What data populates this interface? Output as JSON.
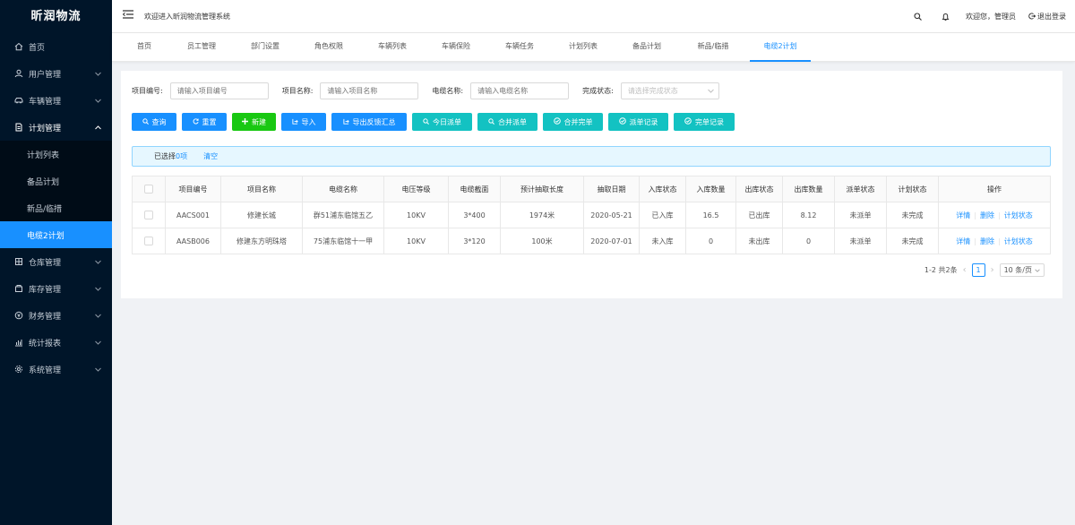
{
  "app": {
    "logo": "昕润物流"
  },
  "sidebar": {
    "items": [
      {
        "label": "首页",
        "icon": "home-icon"
      },
      {
        "label": "用户管理",
        "icon": "user-icon"
      },
      {
        "label": "车辆管理",
        "icon": "car-icon"
      },
      {
        "label": "计划管理",
        "icon": "document-icon"
      },
      {
        "label": "仓库管理",
        "icon": "warehouse-icon"
      },
      {
        "label": "库存管理",
        "icon": "inventory-icon"
      },
      {
        "label": "财务管理",
        "icon": "finance-icon"
      },
      {
        "label": "统计报表",
        "icon": "chart-icon"
      },
      {
        "label": "系统管理",
        "icon": "settings-icon"
      }
    ],
    "submenu": [
      "计划列表",
      "备品计划",
      "新品/临措",
      "电缆2计划"
    ]
  },
  "header": {
    "welcome": "欢迎进入昕润物流管理系统",
    "greeting": "欢迎您，管理员",
    "logout": "退出登录"
  },
  "tabs": [
    "首页",
    "员工管理",
    "部门设置",
    "角色权限",
    "车辆列表",
    "车辆保险",
    "车辆任务",
    "计划列表",
    "备品计划",
    "新品/临措",
    "电缆2计划"
  ],
  "filters": {
    "project_no_label": "项目编号:",
    "project_no_placeholder": "请输入项目编号",
    "project_name_label": "项目名称:",
    "project_name_placeholder": "请输入项目名称",
    "cable_name_label": "电缆名称:",
    "cable_name_placeholder": "请输入电缆名称",
    "status_label": "完成状态:",
    "status_placeholder": "请选择完成状态"
  },
  "buttons": {
    "query": "查询",
    "reset": "重置",
    "create": "新建",
    "import": "导入",
    "export": "导出反馈汇总",
    "today": "今日派单",
    "merge_dispatch": "合并派单",
    "merge_complete": "合并完单",
    "dispatch_log": "派单记录",
    "complete_log": "完单记录"
  },
  "selection": {
    "prefix": "已选择",
    "count": "0项",
    "clear": "清空"
  },
  "table": {
    "headers": [
      "项目编号",
      "项目名称",
      "电缆名称",
      "电压等级",
      "电缆截面",
      "预计抽取长度",
      "抽取日期",
      "入库状态",
      "入库数量",
      "出库状态",
      "出库数量",
      "派单状态",
      "计划状态",
      "操作"
    ],
    "rows": [
      [
        "AACS001",
        "修建长城",
        "群51浦东临馆五乙",
        "10KV",
        "3*400",
        "1974米",
        "2020-05-21",
        "已入库",
        "16.5",
        "已出库",
        "8.12",
        "未派单",
        "未完成"
      ],
      [
        "AASB006",
        "修建东方明珠塔",
        "75浦东临馆十一甲",
        "10KV",
        "3*120",
        "100米",
        "2020-07-01",
        "未入库",
        "0",
        "未出库",
        "0",
        "未派单",
        "未完成"
      ]
    ],
    "actions": [
      "详情",
      "删除",
      "计划状态"
    ]
  },
  "pagination": {
    "summary": "1-2 共2条",
    "page": "1",
    "size": "10 条/页"
  },
  "colors": {
    "sidebar": "#001529",
    "accent": "#1890ff",
    "green": "#19c812",
    "cyan": "#13c2c2"
  }
}
